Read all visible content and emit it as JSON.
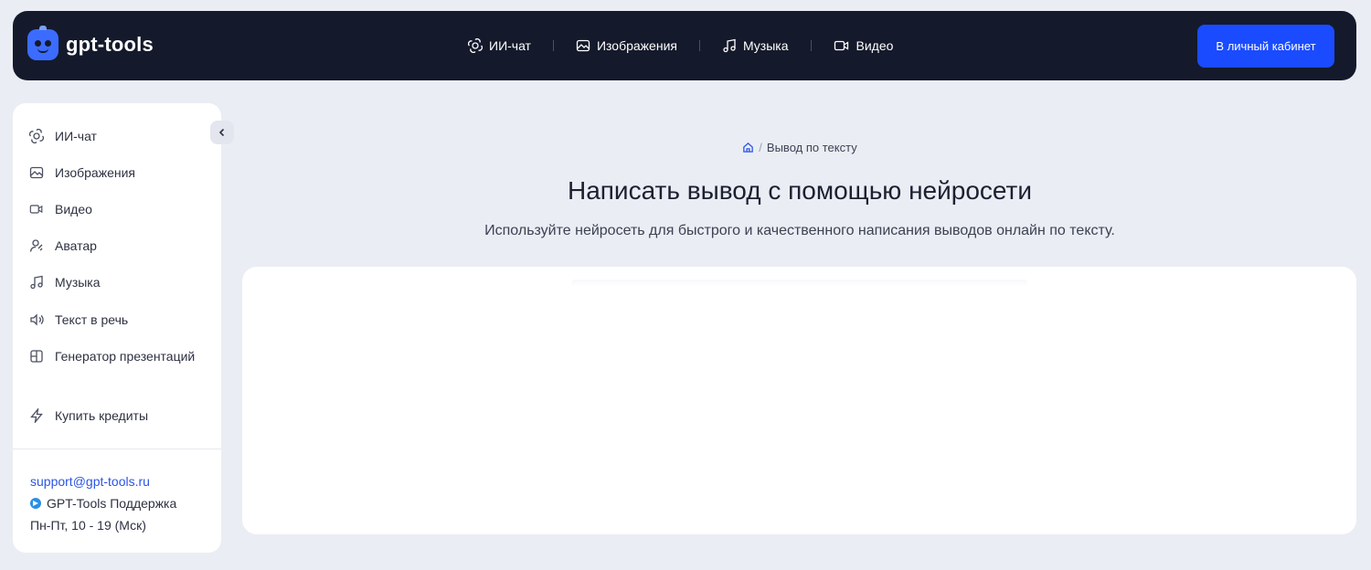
{
  "header": {
    "logo_text": "gpt-tools",
    "nav": [
      {
        "label": "ИИ-чат",
        "icon": "openai-icon"
      },
      {
        "label": "Изображения",
        "icon": "image-icon"
      },
      {
        "label": "Музыка",
        "icon": "music-icon"
      },
      {
        "label": "Видео",
        "icon": "video-icon"
      }
    ],
    "cabinet_button": "В личный кабинет"
  },
  "sidebar": {
    "items": [
      {
        "label": "ИИ-чат",
        "icon": "openai-icon"
      },
      {
        "label": "Изображения",
        "icon": "image-icon"
      },
      {
        "label": "Видео",
        "icon": "video-icon"
      },
      {
        "label": "Аватар",
        "icon": "avatar-icon"
      },
      {
        "label": "Музыка",
        "icon": "music-icon"
      },
      {
        "label": "Текст в речь",
        "icon": "speaker-icon"
      },
      {
        "label": "Генератор презентаций",
        "icon": "presentation-icon"
      }
    ],
    "buy_credits": "Купить кредиты",
    "support_email": "support@gpt-tools.ru",
    "support_telegram": "GPT-Tools Поддержка",
    "support_hours": "Пн-Пт, 10 - 19 (Мск)"
  },
  "main": {
    "breadcrumb_current": "Вывод по тексту",
    "breadcrumb_sep": "/",
    "title": "Написать вывод с помощью нейросети",
    "subtitle": "Используйте нейросеть для быстрого и качественного написания выводов онлайн по тексту."
  },
  "colors": {
    "accent": "#1a4bff",
    "header_bg": "#141a2b",
    "page_bg": "#eaedf4",
    "link": "#2a55e6"
  }
}
